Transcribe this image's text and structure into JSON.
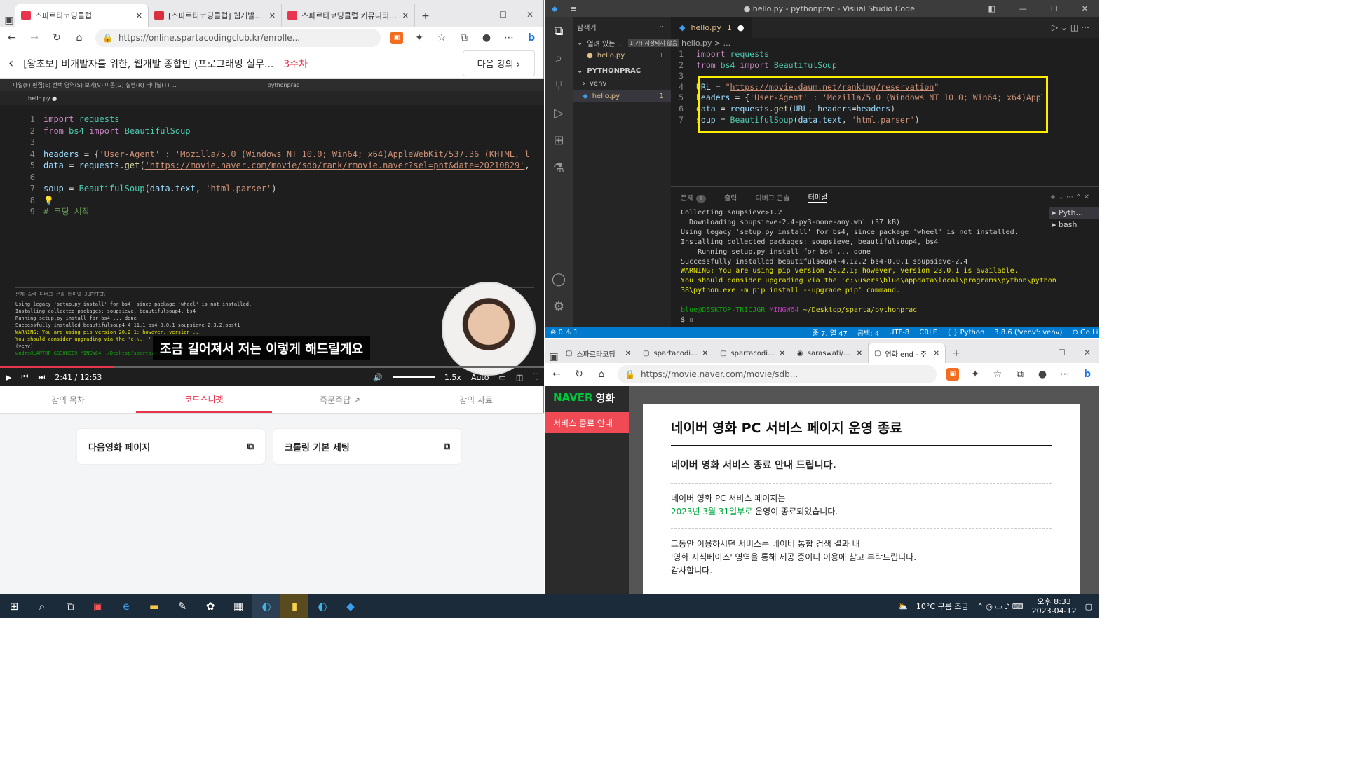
{
  "left_browser": {
    "tabs": [
      {
        "label": "스파르타코딩클럽",
        "color": "#e8344e"
      },
      {
        "label": "[스파르타코딩클럽] 웹개발 종합",
        "color": "#d9303d"
      },
      {
        "label": "스파르타코딩클럽 커뮤니티 | 스",
        "color": "#e8344e"
      }
    ],
    "url": "https://online.spartacodingclub.kr/enrolle...",
    "course_title": "[왕초보] 비개발자를 위한, 웹개발 종합반 (프로그래밍 실무...",
    "week": "3주차",
    "next_label": "다음 강의",
    "video": {
      "window_title": "pythonprac",
      "tab": "hello.py",
      "code_lines": [
        "1",
        "2",
        "3",
        "4",
        "5",
        "6",
        "7",
        "8",
        "9"
      ],
      "subtitle": "조금 길어져서 저는 이렇게 해드릴게요",
      "time_current": "2:41",
      "time_total": "12:53",
      "speed": "1.5x",
      "quality": "Auto",
      "progress": 0.21,
      "terminal_lines": [
        "Using legacy 'setup.py install' for bs4, since package 'wheel' is not installed.",
        "Installing collected packages: soupsieve, beautifulsoup4, bs4",
        "  Running setup.py install for bs4 ... done",
        "Successfully installed beautifulsoup4-4.11.1 bs4-0.0.1 soupsieve-2.3.2.post1",
        "WARNING: You are using pip version 20.2.1; however, version ...",
        "You should consider upgrading via the 'c:\\...'",
        "(venv)",
        "wndms@LAPTOP-G330HCD9 MINGW64 ~/Desktop/sparta/pythonprac"
      ]
    },
    "course_tabs": [
      "강의 목차",
      "코드스니펫",
      "즉문즉답",
      "강의 자료"
    ],
    "active_course_tab": 1,
    "snippets": [
      "다음영화 페이지",
      "크롤링 기본 세팅"
    ]
  },
  "vscode": {
    "title": "● hello.py - pythonprac - Visual Studio Code",
    "explorer_label": "탐색기",
    "open_editors": "열려 있는 ...",
    "unsaved": "1(가) 저장되지 않음",
    "folder": "PYTHONPRAC",
    "tree": [
      "venv",
      "hello.py"
    ],
    "tab": "hello.py",
    "tab_badge": "1",
    "breadcrumb": "hello.py > ...",
    "panel_tabs": [
      "문제",
      "출력",
      "디버그 콘솔",
      "터미널"
    ],
    "problems_count": "1",
    "terminal_list": [
      "Pyth...",
      "bash"
    ],
    "status": {
      "errors": "⊗ 0 ⚠ 1",
      "pos": "줄 7, 열 47",
      "spaces": "공백: 4",
      "enc": "UTF-8",
      "eol": "CRLF",
      "lang": "Python",
      "interp": "3.8.6 ('venv': venv)",
      "golive": "Go Live"
    }
  },
  "right_browser": {
    "tabs": [
      "스파르타코딩",
      "spartacoding",
      "spartacoding",
      "saraswati/inde",
      "영화 end - 주"
    ],
    "url": "https://movie.naver.com/movie/sdb...",
    "logo_naver": "NAVER",
    "logo_movie": "영화",
    "side_button": "서비스 종료 안내",
    "heading": "네이버 영화 PC 서비스 페이지 운영 종료",
    "subheading": "네이버 영화 서비스 종료 안내 드립니다.",
    "p1_a": "네이버 영화 PC 서비스 페이지는",
    "p1_date": "2023년 3월 31일부로",
    "p1_b": " 운영이 종료되었습니다.",
    "p2_a": "그동안 이용하시던 서비스는 네이버 통합 검색 결과 내",
    "p2_b": "'영화 지식베이스' 영역을 통해 제공 중이니 이용에 참고 부탁드립니다.",
    "p2_c": "감사합니다."
  },
  "taskbar": {
    "weather": "10°C 구름 조금",
    "time": "오후 8:33",
    "date": "2023-04-12"
  }
}
